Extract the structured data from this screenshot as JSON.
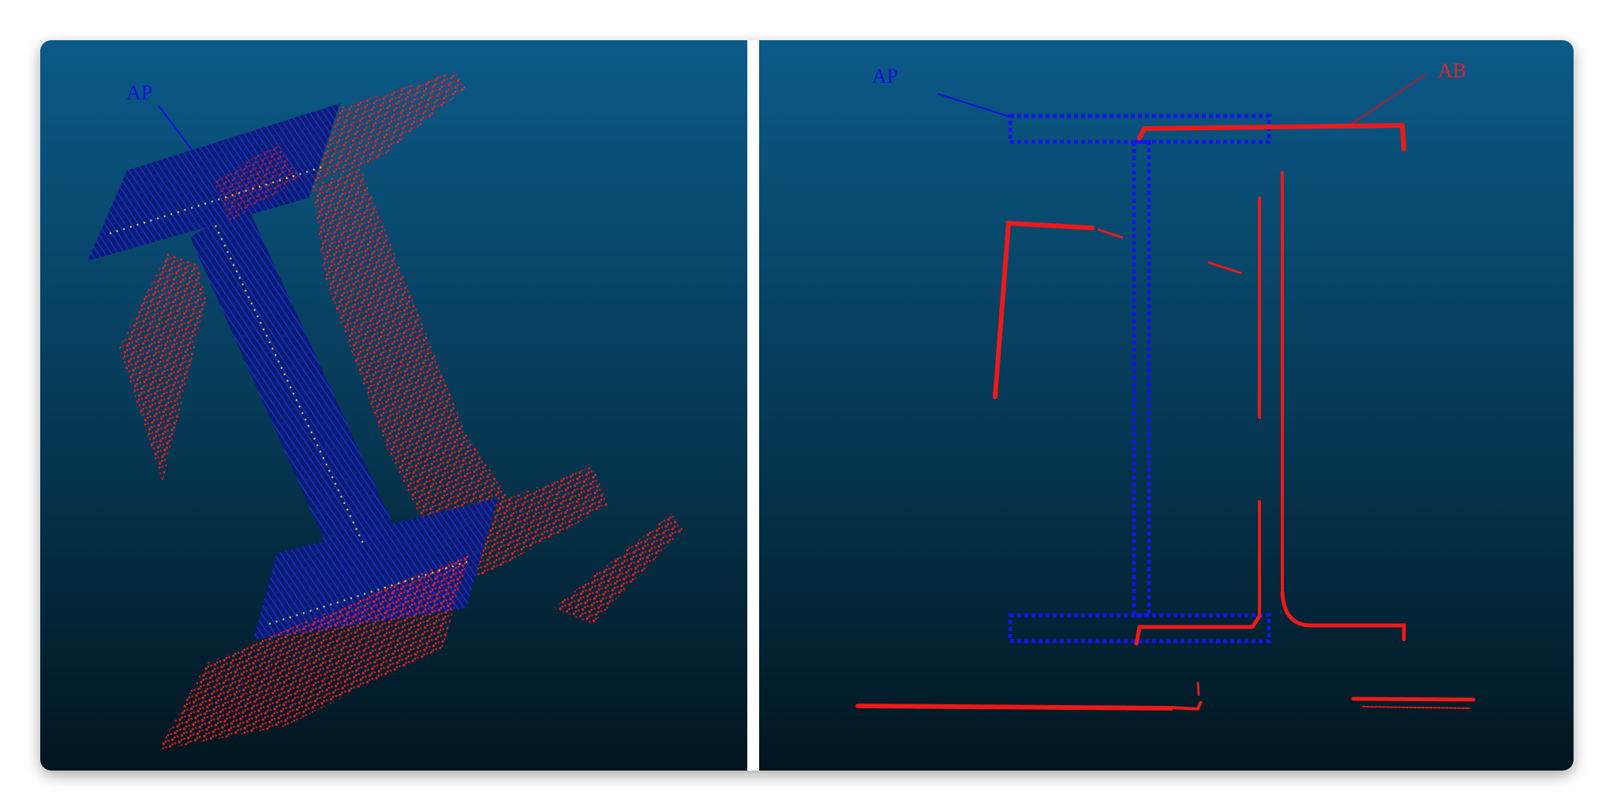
{
  "views": {
    "left": {
      "label_ap": "AP"
    },
    "right": {
      "label_ap": "AP",
      "label_ab": "AB"
    }
  },
  "colors": {
    "ap": "#1010e0",
    "ab": "#e8202a",
    "guide": "#d8e040",
    "background_top": "#0b5a88",
    "background_bottom": "#01151f"
  }
}
